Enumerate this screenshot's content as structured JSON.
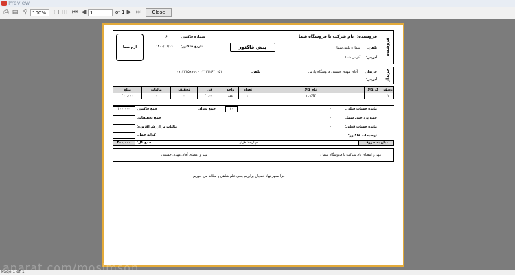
{
  "window": {
    "title": "Preview"
  },
  "toolbar": {
    "zoom": "100%",
    "page_input": "1",
    "page_of": "of 1",
    "close_label": "Close"
  },
  "status": {
    "text": "Page 1 of 1"
  },
  "watermark": "aparat.com/mosimson",
  "invoice": {
    "seller_section": "فروشنده",
    "buyer_section": "خریدار",
    "seller_name_label": "فروشنده:",
    "seller_name": "نام شرکت یا فروشگاه شما",
    "seller_phone_label": "تلفن:",
    "seller_phone": "شماره تلفن شما",
    "seller_address_label": "آدرس:",
    "seller_address": "آدرس شما",
    "doc_title": "پیش فاکتور",
    "invoice_no_label": "شماره فاکتور:",
    "invoice_no": "۶",
    "invoice_date_label": "تاریخ فاکتور:",
    "invoice_date": "۱۴۰۰/۰۱/۱۶",
    "logo_text": "آرم شما",
    "buyer_name_label": "خریدار:",
    "buyer_name": "آقای مهدی حسینی  فروشگاه پارس",
    "buyer_phone_label": "تلفن:",
    "buyer_phone": "۰۲۱۳۴۲۶۳۰۰۵۱ - ۰۹۱۲۳۴۵۹۹۹۹",
    "buyer_address_label": "آدرس:",
    "table": {
      "headers": [
        "ردیف",
        "کد کالا",
        "نام کالا",
        "تعداد",
        "واحد",
        "فی",
        "تخفیف",
        "مالیات",
        "مبلغ"
      ],
      "rows": [
        [
          "۱",
          "",
          "کالای ۱",
          "۱۰",
          "عدد",
          "۴۰,۰۰۰",
          "۰",
          "۰",
          "۴۰۰,۰۰۰"
        ]
      ]
    },
    "totals": {
      "sum_count_label": "جمع تعداد:",
      "sum_count": "۱۰",
      "sum_invoice_label": "جمع فاکتور:",
      "sum_invoice": "۴۰۰,۰۰۰",
      "sum_discount_label": "جمع تخفیفات:",
      "sum_discount": "۰",
      "vat_label": "مالیات بر ارزش افزوده:",
      "vat": "۰",
      "freight_label": "کرایه حمل:",
      "freight": "۰",
      "total_label": "جمع کل:",
      "total": "۴۰۰,۰۰۰",
      "prev_balance_label": "مانده حساب قبلی:",
      "prev_balance": "-",
      "paid_label": "جمع پرداختی شما:",
      "paid": "-",
      "current_balance_label": "مانده حساب فعلی:",
      "current_balance": "-",
      "notes_label": "توضیحات فاکتور:",
      "words_label": "مبلغ به حروف",
      "words_value": "چهارصد هزار"
    },
    "sign_left": "مهر و امضای آقای مهدی حسینی",
    "sign_right": "مهر و امضای نام شرکت یا فروشگاه شما :",
    "footer": "جزاً معهز نهاد خمایان برابریم     یعنی علم شاهی و میلاند می خوریم"
  }
}
